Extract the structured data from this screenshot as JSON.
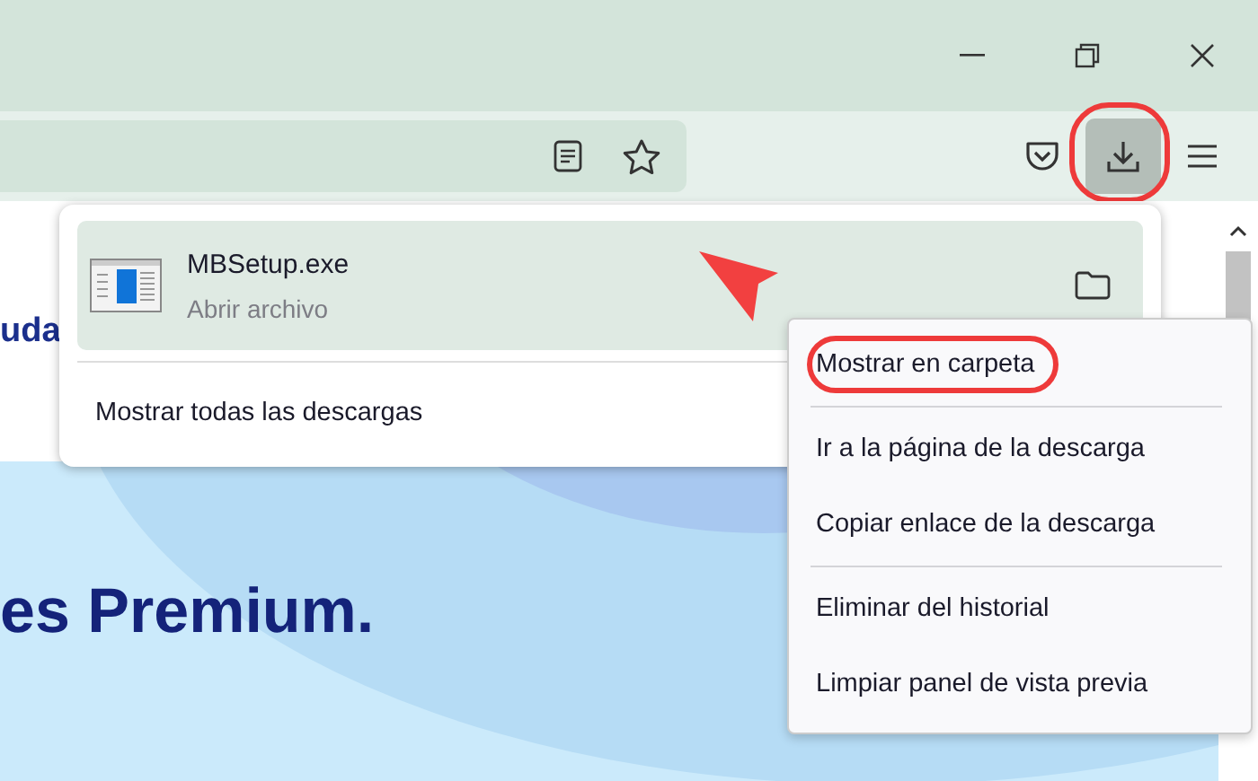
{
  "toolbar": {
    "downloads_button": {
      "active": true,
      "circled": true
    }
  },
  "page": {
    "text_fragment": "uda",
    "headline": "es Premium."
  },
  "downloads_panel": {
    "items": [
      {
        "filename": "MBSetup.exe",
        "status": "Abrir archivo",
        "selected": true
      }
    ],
    "footer": "Mostrar todas las descargas"
  },
  "context_menu": {
    "items": [
      {
        "kind": "item",
        "label": "Mostrar en carpeta",
        "circled": true
      },
      {
        "kind": "separator"
      },
      {
        "kind": "item",
        "label": "Ir a la página de la descarga",
        "circled": false
      },
      {
        "kind": "item",
        "label": "Copiar enlace de la descarga",
        "circled": false
      },
      {
        "kind": "separator"
      },
      {
        "kind": "item",
        "label": "Eliminar del historial",
        "circled": false
      },
      {
        "kind": "item",
        "label": "Limpiar panel de vista previa",
        "circled": false
      }
    ]
  }
}
